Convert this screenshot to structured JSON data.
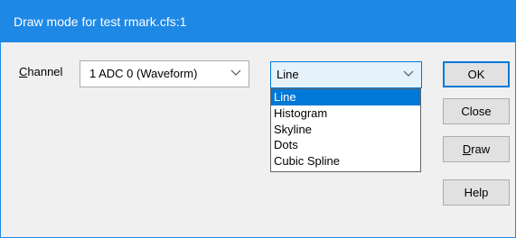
{
  "window": {
    "title": "Draw mode for test rmark.cfs:1"
  },
  "channel": {
    "label_first": "C",
    "label_rest": "hannel",
    "selected": "1 ADC 0 (Waveform)"
  },
  "mode": {
    "selected": "Line",
    "options": [
      "Line",
      "Histogram",
      "Skyline",
      "Dots",
      "Cubic Spline"
    ],
    "highlighted_index": 0
  },
  "buttons": {
    "ok": "OK",
    "close": "Close",
    "draw_first": "D",
    "draw_rest": "raw",
    "help": "Help"
  },
  "colors": {
    "titlebar": "#1e88e5",
    "selection": "#0078d7"
  }
}
